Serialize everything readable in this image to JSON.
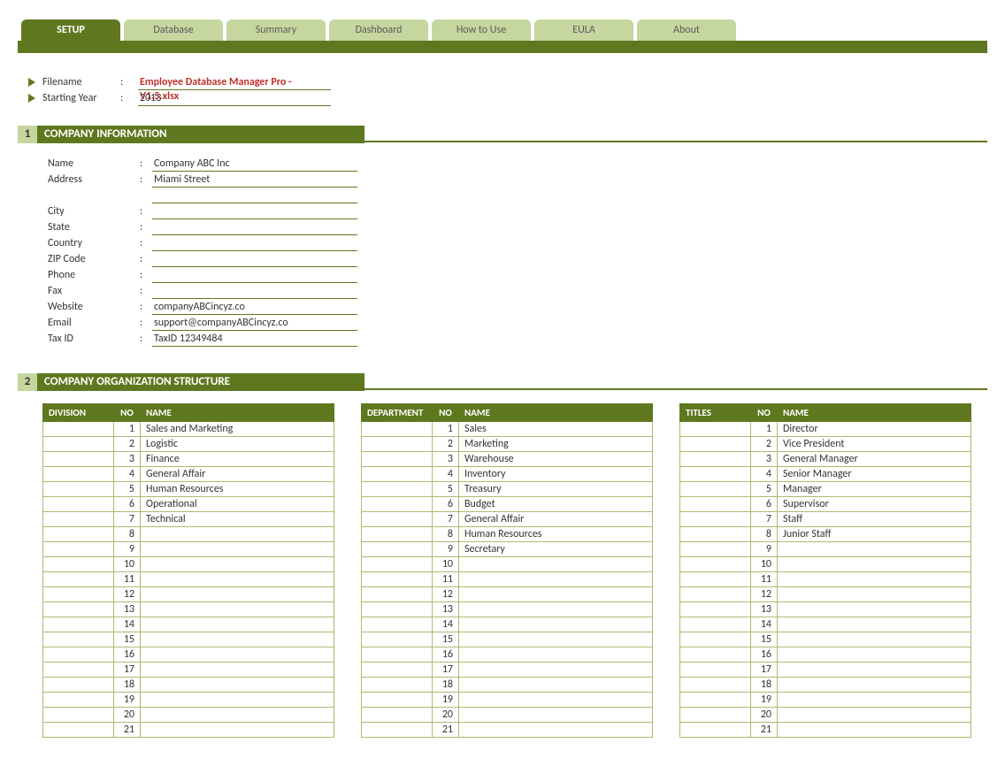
{
  "tabs": [
    {
      "label": "SETUP",
      "active": true
    },
    {
      "label": "Database",
      "active": false
    },
    {
      "label": "Summary",
      "active": false
    },
    {
      "label": "Dashboard",
      "active": false
    },
    {
      "label": "How to Use",
      "active": false
    },
    {
      "label": "EULA",
      "active": false
    },
    {
      "label": "About",
      "active": false
    }
  ],
  "top_info": {
    "filename_label": "Filename",
    "filename_value": "Employee Database Manager Pro - V1.5.xlsx",
    "starting_year_label": "Starting Year",
    "starting_year_value": "2013"
  },
  "section1": {
    "num": "1",
    "title": "COMPANY INFORMATION"
  },
  "company": {
    "fields": [
      {
        "label": "Name",
        "value": "Company ABC Inc"
      },
      {
        "label": "Address",
        "value": "Miami Street"
      },
      {
        "label": "",
        "value": ""
      },
      {
        "label": "City",
        "value": ""
      },
      {
        "label": "State",
        "value": ""
      },
      {
        "label": "Country",
        "value": ""
      },
      {
        "label": "ZIP Code",
        "value": ""
      },
      {
        "label": "Phone",
        "value": ""
      },
      {
        "label": "Fax",
        "value": ""
      },
      {
        "label": "Website",
        "value": "companyABCincyz.co"
      },
      {
        "label": "Email",
        "value": "support@companyABCincyz.co"
      },
      {
        "label": "Tax ID",
        "value": "TaxID 12349484"
      }
    ]
  },
  "section2": {
    "num": "2",
    "title": "COMPANY ORGANIZATION STRUCTURE"
  },
  "org_headers": {
    "division": "DIVISION",
    "department": "DEPARTMENT",
    "titles": "TITLES",
    "no": "NO",
    "name": "NAME"
  },
  "divisions": [
    "Sales and Marketing",
    "Logistic",
    "Finance",
    "General Affair",
    "Human Resources",
    "Operational",
    "Technical",
    "",
    "",
    "",
    "",
    "",
    "",
    "",
    "",
    "",
    "",
    "",
    "",
    "",
    ""
  ],
  "departments": [
    "Sales",
    "Marketing",
    "Warehouse",
    "Inventory",
    "Treasury",
    "Budget",
    "General Affair",
    "Human Resources",
    "Secretary",
    "",
    "",
    "",
    "",
    "",
    "",
    "",
    "",
    "",
    "",
    "",
    ""
  ],
  "titles": [
    "Director",
    "Vice President",
    "General Manager",
    "Senior Manager",
    "Manager",
    "Supervisor",
    "Staff",
    "Junior Staff",
    "",
    "",
    "",
    "",
    "",
    "",
    "",
    "",
    "",
    "",
    "",
    "",
    ""
  ],
  "row_count": 21
}
